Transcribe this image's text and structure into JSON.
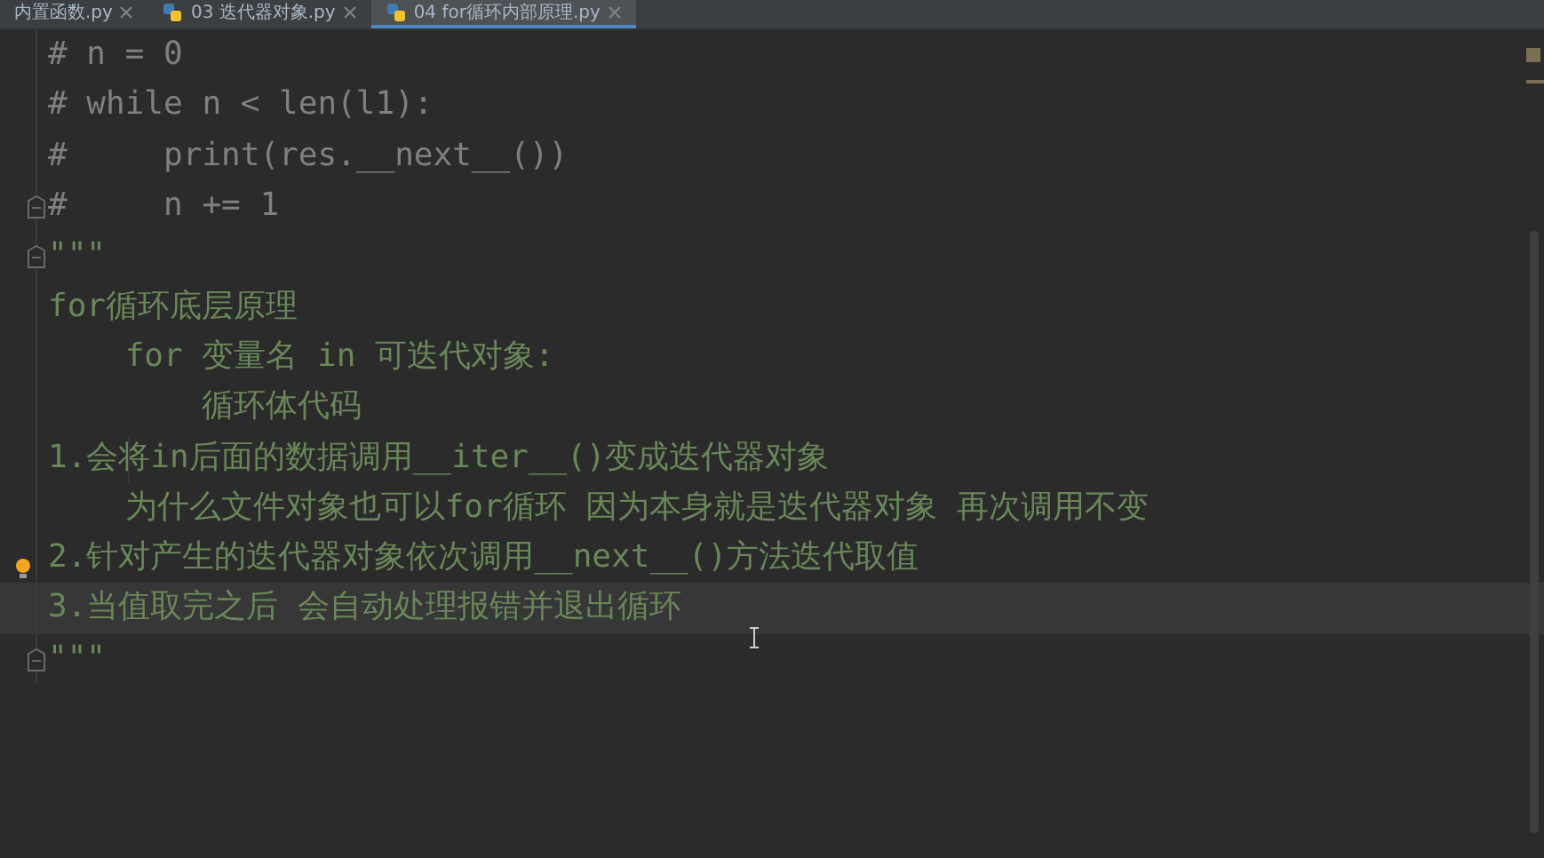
{
  "tabs": [
    {
      "label": "内置函数.py",
      "selected": false
    },
    {
      "label": "03 迭代器对象.py",
      "selected": false
    },
    {
      "label": "04 for循环内部原理.py",
      "selected": true
    }
  ],
  "lines": [
    {
      "text": "# n = 0",
      "kind": "comment",
      "fold": false,
      "bulb": false,
      "current": false
    },
    {
      "text": "# while n < len(l1):",
      "kind": "comment",
      "fold": false,
      "bulb": false,
      "current": false
    },
    {
      "text": "#     print(res.__next__())",
      "kind": "comment",
      "fold": false,
      "bulb": false,
      "current": false
    },
    {
      "text": "#     n += 1",
      "kind": "comment",
      "fold": true,
      "bulb": false,
      "current": false
    },
    {
      "text": "\"\"\"",
      "kind": "docstring",
      "fold": true,
      "bulb": false,
      "current": false
    },
    {
      "text": "for循环底层原理",
      "kind": "docstring",
      "fold": false,
      "bulb": false,
      "current": false
    },
    {
      "text": "    for 变量名 in 可迭代对象:",
      "kind": "docstring",
      "fold": false,
      "bulb": false,
      "current": false
    },
    {
      "text": "        循环体代码",
      "kind": "docstring",
      "fold": false,
      "bulb": false,
      "current": false
    },
    {
      "text": "1.会将in后面的数据调用__iter__()变成迭代器对象",
      "kind": "docstring",
      "fold": false,
      "bulb": false,
      "current": false
    },
    {
      "text": "    为什么文件对象也可以for循环 因为本身就是迭代器对象 再次调用不变",
      "kind": "docstring",
      "fold": false,
      "bulb": false,
      "current": false
    },
    {
      "text": "2.针对产生的迭代器对象依次调用__next__()方法迭代取值",
      "kind": "docstring",
      "fold": false,
      "bulb": true,
      "current": false
    },
    {
      "text": "3.当值取完之后 会自动处理报错并退出循环",
      "kind": "docstring",
      "fold": false,
      "bulb": false,
      "current": true
    },
    {
      "text": "\"\"\"",
      "kind": "docstring",
      "fold": true,
      "bulb": false,
      "current": false
    }
  ]
}
